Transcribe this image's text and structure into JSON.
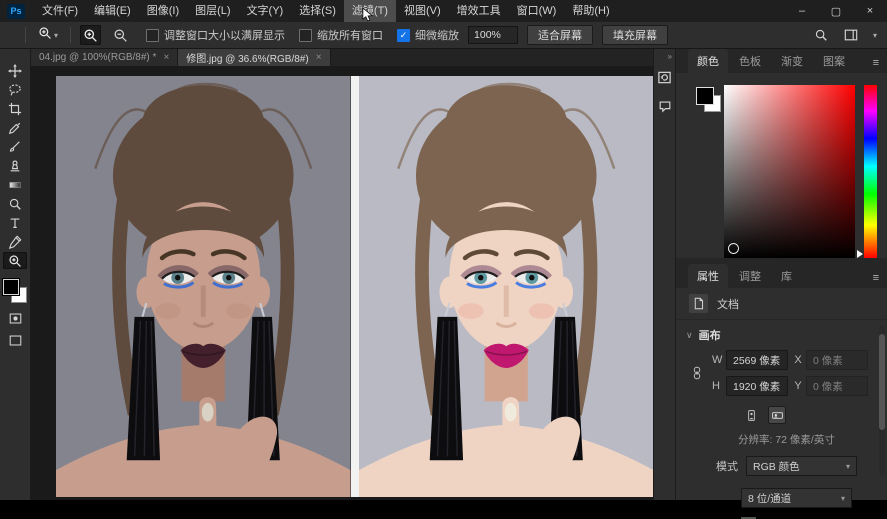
{
  "icons": {
    "check": "✓",
    "chevron_down": "∨",
    "dropdown_small": "▾",
    "collapse_right": "»",
    "close_tab": "×",
    "minimize": "–",
    "maximize": "▢",
    "close": "×",
    "menu": "≡"
  },
  "titlebar": {
    "logo": "Ps",
    "controls": {
      "minimize": "–",
      "maximize": "▢",
      "close": "×"
    }
  },
  "menu": {
    "items": [
      {
        "label": "文件(F)"
      },
      {
        "label": "编辑(E)"
      },
      {
        "label": "图像(I)"
      },
      {
        "label": "图层(L)"
      },
      {
        "label": "文字(Y)"
      },
      {
        "label": "选择(S)"
      },
      {
        "label": "滤镜(T)",
        "highlighted": true
      },
      {
        "label": "视图(V)"
      },
      {
        "label": "增效工具"
      },
      {
        "label": "窗口(W)"
      },
      {
        "label": "帮助(H)"
      }
    ]
  },
  "options_bar": {
    "checkboxes": [
      {
        "label": "调整窗口大小以满屏显示",
        "checked": false
      },
      {
        "label": "缩放所有窗口",
        "checked": false
      },
      {
        "label": "细微缩放",
        "checked": true
      }
    ],
    "zoom_value": "100%",
    "buttons": [
      {
        "label": "适合屏幕"
      },
      {
        "label": "填充屏幕"
      }
    ]
  },
  "tabs": [
    {
      "label": "04.jpg @ 100%(RGB/8#) *",
      "active": false
    },
    {
      "label": "修图.jpg @ 36.6%(RGB/8#)",
      "active": true
    }
  ],
  "toolbar": {
    "tools": [
      {
        "name": "move-tool",
        "icon": "move"
      },
      {
        "name": "lasso-tool",
        "icon": "lasso"
      },
      {
        "name": "crop-tool",
        "icon": "crop"
      },
      {
        "name": "eyedropper-tool",
        "icon": "eyedropper"
      },
      {
        "name": "brush-tool",
        "icon": "brush"
      },
      {
        "name": "clone-stamp-tool",
        "icon": "stamp"
      },
      {
        "name": "gradient-tool",
        "icon": "gradient"
      },
      {
        "name": "dodge-tool",
        "icon": "dodge"
      },
      {
        "name": "type-tool",
        "icon": "type"
      },
      {
        "name": "pen-tool",
        "icon": "pen"
      },
      {
        "name": "zoom-tool",
        "icon": "zoom",
        "active": true
      }
    ]
  },
  "color_panel": {
    "tabs": [
      {
        "label": "颜色",
        "active": true
      },
      {
        "label": "色板",
        "active": false
      },
      {
        "label": "渐变",
        "active": false
      },
      {
        "label": "图案",
        "active": false
      }
    ]
  },
  "properties_panel": {
    "tabs": [
      {
        "label": "属性",
        "active": true
      },
      {
        "label": "调整",
        "active": false
      },
      {
        "label": "库",
        "active": false
      }
    ],
    "document_label": "文档",
    "canvas_section": "画布",
    "w_label": "W",
    "w_value": "2569 像素",
    "x_label": "X",
    "x_value": "0 像素",
    "h_label": "H",
    "h_value": "1920 像素",
    "y_label": "Y",
    "y_value": "0 像素",
    "resolution": "分辨率: 72 像素/英寸",
    "mode_label": "模式",
    "mode_value": "RGB 颜色",
    "depth_value": "8 位/通道"
  },
  "theme": {
    "accent": "#1473e6",
    "portrait_before": {
      "bg": "#84848e",
      "skin": "#c79e8d",
      "skin-sh": "#a57b6b",
      "hair": "#5f4b3d",
      "lips": "#44202d",
      "iris": "#5c838c",
      "liner": "#3f6fd0",
      "blush": "#b98878",
      "nail": "#d9d2c4",
      "brow": "#473626",
      "shadow": "#4a2f45"
    },
    "portrait_after": {
      "bg": "#b9bac4",
      "skin": "#efd3c3",
      "skin-sh": "#d0a48e",
      "hair": "#7d6450",
      "lips": "#c0186f",
      "iris": "#5f9aa2",
      "liner": "#4a7de0",
      "blush": "#eda394",
      "nail": "#f0eadd",
      "brow": "#5d4936",
      "shadow": "#6b3f63"
    }
  }
}
